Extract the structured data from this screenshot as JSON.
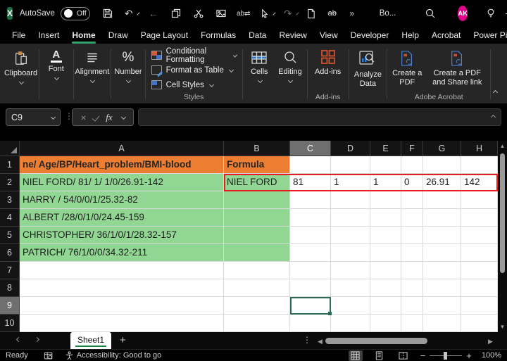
{
  "titlebar": {
    "autosave_label": "AutoSave",
    "autosave_state": "Off",
    "workbook_name": "Bo...",
    "avatar_initials": "AK",
    "more_commands": "»"
  },
  "ribbon": {
    "tabs": [
      "File",
      "Insert",
      "Home",
      "Draw",
      "Page Layout",
      "Formulas",
      "Data",
      "Review",
      "View",
      "Developer",
      "Help",
      "Acrobat",
      "Power Pivot"
    ],
    "active_tab": "Home",
    "groups": {
      "clipboard": "Clipboard",
      "font": "Font",
      "alignment": "Alignment",
      "number": "Number",
      "styles": {
        "items": [
          "Conditional Formatting",
          "Format as Table",
          "Cell Styles"
        ],
        "label": "Styles"
      },
      "cells": "Cells",
      "editing": "Editing",
      "addins_button": "Add-ins",
      "addins_group": "Add-ins",
      "analyze_data": "Analyze Data",
      "create_pdf": "Create a PDF",
      "create_pdf_share": "Create a PDF and Share link",
      "acrobat_group": "Adobe Acrobat"
    }
  },
  "formula_bar": {
    "name_box": "C9",
    "fx_label": "fx",
    "formula_value": ""
  },
  "grid": {
    "columns": [
      "A",
      "B",
      "C",
      "D",
      "E",
      "F",
      "G",
      "H"
    ],
    "rows": [
      "1",
      "2",
      "3",
      "4",
      "5",
      "6",
      "7",
      "8",
      "9",
      "10"
    ],
    "selected_cell": "C9",
    "red_border_range": "B2:H2",
    "colors": {
      "orange": "#ED7D31",
      "green": "#92D694",
      "red": "#E8191F",
      "selection": "#2A6B51"
    },
    "cells": {
      "A1": {
        "text": "ne/ Age/BP/Heart_problem/BMI-blood",
        "fill": "orange",
        "bold": true
      },
      "B1": {
        "text": "Formula",
        "fill": "orange",
        "bold": true
      },
      "A2": {
        "text": "NIEL FORD/ 81/ 1/ 1/0/26.91-142",
        "fill": "green"
      },
      "B2": {
        "text": "NIEL FORD",
        "fill": "green"
      },
      "C2": {
        "text": "81"
      },
      "D2": {
        "text": "1"
      },
      "E2": {
        "text": "1"
      },
      "F2": {
        "text": "0"
      },
      "G2": {
        "text": "26.91"
      },
      "H2": {
        "text": "142"
      },
      "A3": {
        "text": "HARRY / 54/0/0/1/25.32-82",
        "fill": "green"
      },
      "B3": {
        "fill": "green"
      },
      "A4": {
        "text": "ALBERT /28/0/1/0/24.45-159",
        "fill": "green"
      },
      "B4": {
        "fill": "green"
      },
      "A5": {
        "text": "CHRISTOPHER/ 36/1/0/1/28.32-157",
        "fill": "green"
      },
      "B5": {
        "fill": "green"
      },
      "A6": {
        "text": "PATRICH/ 76/1/0/0/34.32-211",
        "fill": "green"
      },
      "B6": {
        "fill": "green"
      }
    }
  },
  "sheet_tabs": {
    "active": "Sheet1"
  },
  "status_bar": {
    "ready": "Ready",
    "accessibility": "Accessibility: Good to go",
    "zoom_level": "100%"
  }
}
